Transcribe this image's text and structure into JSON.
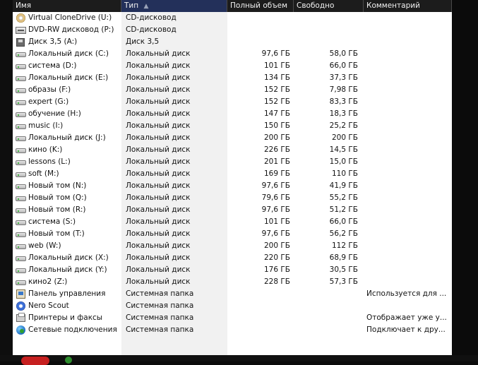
{
  "columns": [
    {
      "label": "Имя"
    },
    {
      "label": "Тип",
      "sort_icon": "▲"
    },
    {
      "label": "Полный объем"
    },
    {
      "label": "Свободно"
    },
    {
      "label": "Комментарий"
    }
  ],
  "rows": [
    {
      "icon": "cd-drive-icon",
      "name": "Virtual CloneDrive (U:)",
      "type": "CD-дисковод",
      "total": "",
      "free": "",
      "comment": ""
    },
    {
      "icon": "dvd-drive-icon",
      "name": "DVD-RW дисковод (P:)",
      "type": "CD-дисковод",
      "total": "",
      "free": "",
      "comment": ""
    },
    {
      "icon": "floppy-drive-icon",
      "name": "Диск 3,5 (A:)",
      "type": "Диск 3,5",
      "total": "",
      "free": "",
      "comment": ""
    },
    {
      "icon": "hard-disk-icon",
      "name": "Локальный диск (C:)",
      "type": "Локальный диск",
      "total": "97,6 ГБ",
      "free": "58,0 ГБ",
      "comment": ""
    },
    {
      "icon": "hard-disk-icon",
      "name": "система (D:)",
      "type": "Локальный диск",
      "total": "101 ГБ",
      "free": "66,0 ГБ",
      "comment": ""
    },
    {
      "icon": "hard-disk-icon",
      "name": "Локальный диск (E:)",
      "type": "Локальный диск",
      "total": "134 ГБ",
      "free": "37,3 ГБ",
      "comment": ""
    },
    {
      "icon": "hard-disk-icon",
      "name": "образы (F:)",
      "type": "Локальный диск",
      "total": "152 ГБ",
      "free": "7,98 ГБ",
      "comment": ""
    },
    {
      "icon": "hard-disk-icon",
      "name": "expert (G:)",
      "type": "Локальный диск",
      "total": "152 ГБ",
      "free": "83,3 ГБ",
      "comment": ""
    },
    {
      "icon": "hard-disk-icon",
      "name": "обучение (H:)",
      "type": "Локальный диск",
      "total": "147 ГБ",
      "free": "18,3 ГБ",
      "comment": ""
    },
    {
      "icon": "hard-disk-icon",
      "name": "music (I:)",
      "type": "Локальный диск",
      "total": "150 ГБ",
      "free": "25,2 ГБ",
      "comment": ""
    },
    {
      "icon": "hard-disk-icon",
      "name": "Локальный диск (J:)",
      "type": "Локальный диск",
      "total": "200 ГБ",
      "free": "200 ГБ",
      "comment": ""
    },
    {
      "icon": "hard-disk-icon",
      "name": "кино (K:)",
      "type": "Локальный диск",
      "total": "226 ГБ",
      "free": "14,5 ГБ",
      "comment": ""
    },
    {
      "icon": "hard-disk-icon",
      "name": "lessons (L:)",
      "type": "Локальный диск",
      "total": "201 ГБ",
      "free": "15,0 ГБ",
      "comment": ""
    },
    {
      "icon": "hard-disk-icon",
      "name": "soft (M:)",
      "type": "Локальный диск",
      "total": "169 ГБ",
      "free": "110 ГБ",
      "comment": ""
    },
    {
      "icon": "hard-disk-icon",
      "name": "Новый том (N:)",
      "type": "Локальный диск",
      "total": "97,6 ГБ",
      "free": "41,9 ГБ",
      "comment": ""
    },
    {
      "icon": "hard-disk-icon",
      "name": "Новый том (Q:)",
      "type": "Локальный диск",
      "total": "79,6 ГБ",
      "free": "55,2 ГБ",
      "comment": ""
    },
    {
      "icon": "hard-disk-icon",
      "name": "Новый том (R:)",
      "type": "Локальный диск",
      "total": "97,6 ГБ",
      "free": "51,2 ГБ",
      "comment": ""
    },
    {
      "icon": "hard-disk-icon",
      "name": "система (S:)",
      "type": "Локальный диск",
      "total": "101 ГБ",
      "free": "66,0 ГБ",
      "comment": ""
    },
    {
      "icon": "hard-disk-icon",
      "name": "Новый том (T:)",
      "type": "Локальный диск",
      "total": "97,6 ГБ",
      "free": "56,2 ГБ",
      "comment": ""
    },
    {
      "icon": "hard-disk-icon",
      "name": "web  (W:)",
      "type": "Локальный диск",
      "total": "200 ГБ",
      "free": "112 ГБ",
      "comment": ""
    },
    {
      "icon": "hard-disk-icon",
      "name": "Локальный диск (X:)",
      "type": "Локальный диск",
      "total": "220 ГБ",
      "free": "68,9 ГБ",
      "comment": ""
    },
    {
      "icon": "hard-disk-icon",
      "name": "Локальный диск (Y:)",
      "type": "Локальный диск",
      "total": "176 ГБ",
      "free": "30,5 ГБ",
      "comment": ""
    },
    {
      "icon": "hard-disk-icon",
      "name": "кино2 (Z:)",
      "type": "Локальный диск",
      "total": "228 ГБ",
      "free": "57,3 ГБ",
      "comment": ""
    },
    {
      "icon": "control-panel-icon",
      "name": "Панель управления",
      "type": "Системная папка",
      "total": "",
      "free": "",
      "comment": "Используется для ..."
    },
    {
      "icon": "nero-scout-icon",
      "name": "Nero Scout",
      "type": "Системная папка",
      "total": "",
      "free": "",
      "comment": ""
    },
    {
      "icon": "printer-icon",
      "name": "Принтеры и факсы",
      "type": "Системная папка",
      "total": "",
      "free": "",
      "comment": "Отображает уже у..."
    },
    {
      "icon": "network-connections-icon",
      "name": "Сетевые подключения",
      "type": "Системная папка",
      "total": "",
      "free": "",
      "comment": "Подключает к дру..."
    }
  ]
}
